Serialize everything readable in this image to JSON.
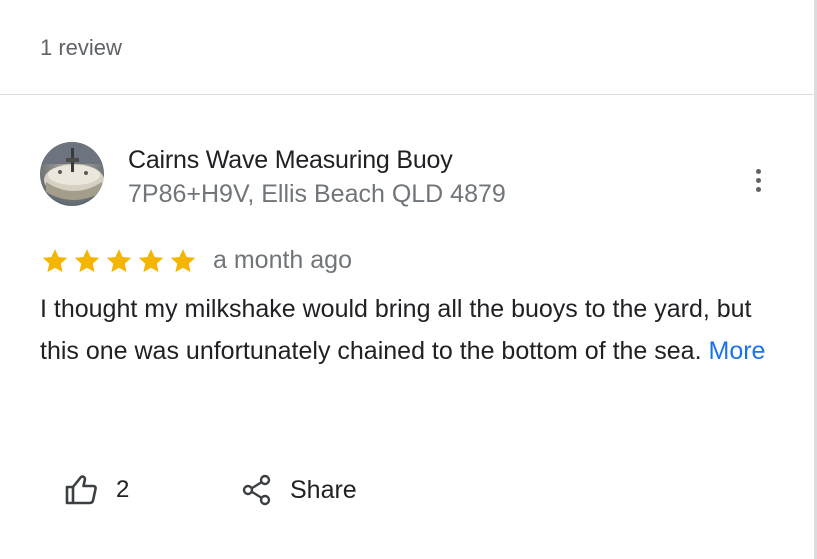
{
  "header": {
    "review_count": "1 review"
  },
  "review": {
    "author_name": "Cairns Wave Measuring Buoy",
    "author_subtitle": "7P86+H9V, Ellis Beach QLD 4879",
    "rating": 5,
    "rating_max": 5,
    "date": "a month ago",
    "text": "I thought my milkshake would bring all the buoys to the yard, but this one was unfortunately chained to the bottom of the sea.",
    "more_label": "More"
  },
  "actions": {
    "like_count": "2",
    "share_label": "Share"
  },
  "icons": {
    "menu": "more-vertical-icon",
    "like": "thumbs-up-icon",
    "share": "share-icon",
    "star": "star-icon"
  },
  "colors": {
    "star": "#f4b400",
    "link": "#1a73e8",
    "secondary_text": "#70757a",
    "divider": "#dadce0"
  }
}
